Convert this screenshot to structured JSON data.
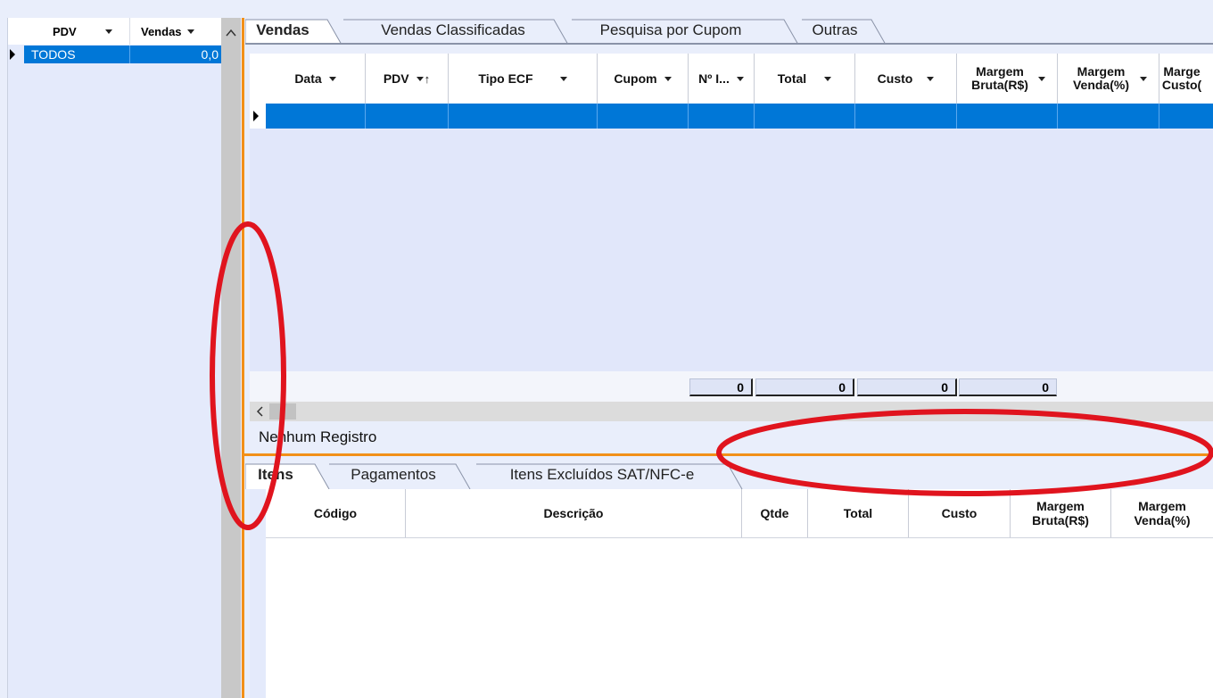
{
  "left_grid": {
    "col_pdv": "PDV",
    "col_vendas": "Vendas",
    "row": {
      "pdv": "TODOS",
      "vendas": "0,0"
    }
  },
  "tabs_top": [
    "Vendas",
    "Vendas Classificadas",
    "Pesquisa por Cupom",
    "Outras"
  ],
  "vendas_grid": {
    "columns": [
      "Data",
      "PDV",
      "Tipo ECF",
      "Cupom",
      "Nº I...",
      "Total",
      "Custo",
      "Margem Bruta(R$)",
      "Margem Venda(%)",
      "Marge Custo("
    ],
    "totals": [
      "0",
      "0",
      "0",
      "0"
    ]
  },
  "status": "Nenhum Registro",
  "tabs_bottom": [
    "Itens",
    "Pagamentos",
    "Itens Excluídos SAT/NFC-e"
  ],
  "itens_grid": {
    "columns": [
      "Código",
      "Descrição",
      "Qtde",
      "Total",
      "Custo",
      "Margem Bruta(R$)",
      "Margem Venda(%)"
    ]
  },
  "colors": {
    "selection": "#0077d7",
    "splitter": "#f29018",
    "annotation": "#e0141e",
    "background": "#e9eefb"
  }
}
